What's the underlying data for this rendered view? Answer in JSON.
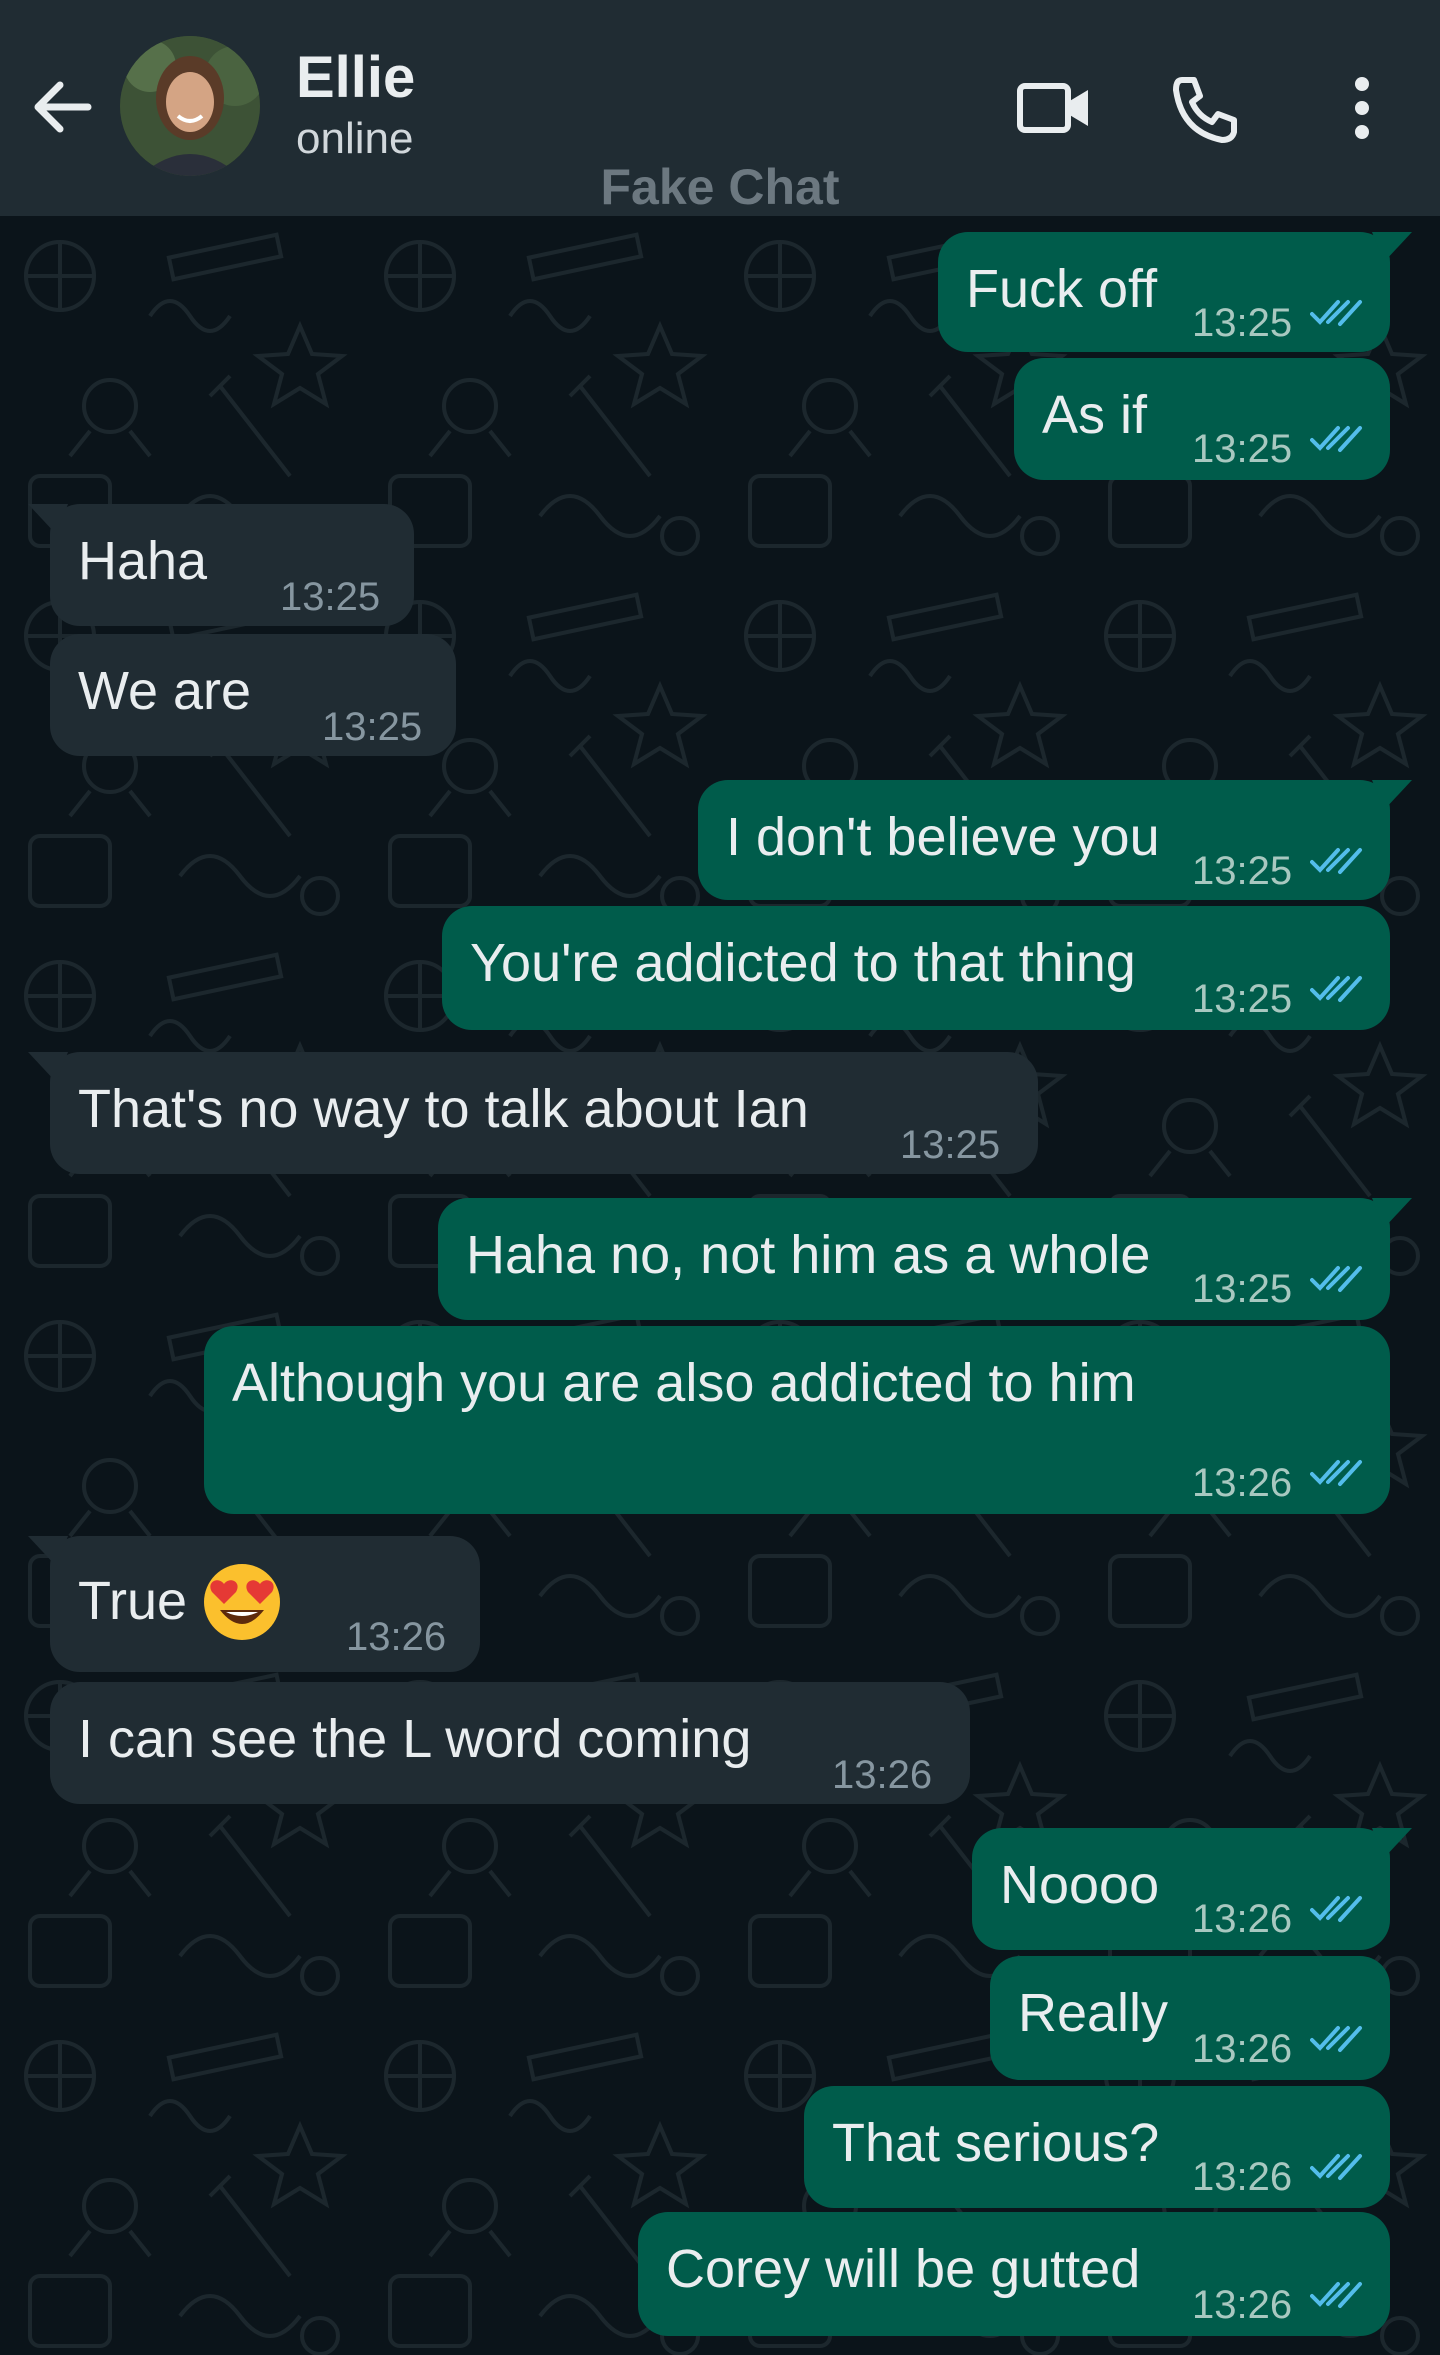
{
  "header": {
    "contact_name": "Ellie",
    "contact_status": "online",
    "watermark": "Fake Chat",
    "icons": [
      "back-arrow-icon",
      "video-call-icon",
      "phone-call-icon",
      "more-options-icon"
    ],
    "colors": {
      "header_bg": "#202c33",
      "chat_bg": "#0b141a",
      "outgoing_bubble": "#005c4b",
      "incoming_bubble": "#202c33",
      "read_ticks": "#53bdeb"
    }
  },
  "messages": [
    {
      "direction": "out",
      "text": "Fuck off",
      "time": "13:25",
      "status": "read"
    },
    {
      "direction": "out",
      "text": "As if",
      "time": "13:25",
      "status": "read"
    },
    {
      "direction": "in",
      "text": "Haha",
      "time": "13:25"
    },
    {
      "direction": "in",
      "text": "We are",
      "time": "13:25"
    },
    {
      "direction": "out",
      "text": "I don't believe you",
      "time": "13:25",
      "status": "read"
    },
    {
      "direction": "out",
      "text": "You're addicted to that thing",
      "time": "13:25",
      "status": "read"
    },
    {
      "direction": "in",
      "text": "That's no way to talk about Ian",
      "time": "13:25"
    },
    {
      "direction": "out",
      "text": "Haha no, not him as a whole",
      "time": "13:25",
      "status": "read"
    },
    {
      "direction": "out",
      "text": "Although you are also addicted to him",
      "time": "13:26",
      "status": "read"
    },
    {
      "direction": "in",
      "text": "True",
      "emoji": "heart-eyes-emoji",
      "time": "13:26"
    },
    {
      "direction": "in",
      "text": "I can see the L word coming",
      "time": "13:26"
    },
    {
      "direction": "out",
      "text": "Noooo",
      "time": "13:26",
      "status": "read"
    },
    {
      "direction": "out",
      "text": "Really",
      "time": "13:26",
      "status": "read"
    },
    {
      "direction": "out",
      "text": "That serious?",
      "time": "13:26",
      "status": "read"
    },
    {
      "direction": "out",
      "text": "Corey will be gutted",
      "time": "13:26",
      "status": "read"
    }
  ]
}
